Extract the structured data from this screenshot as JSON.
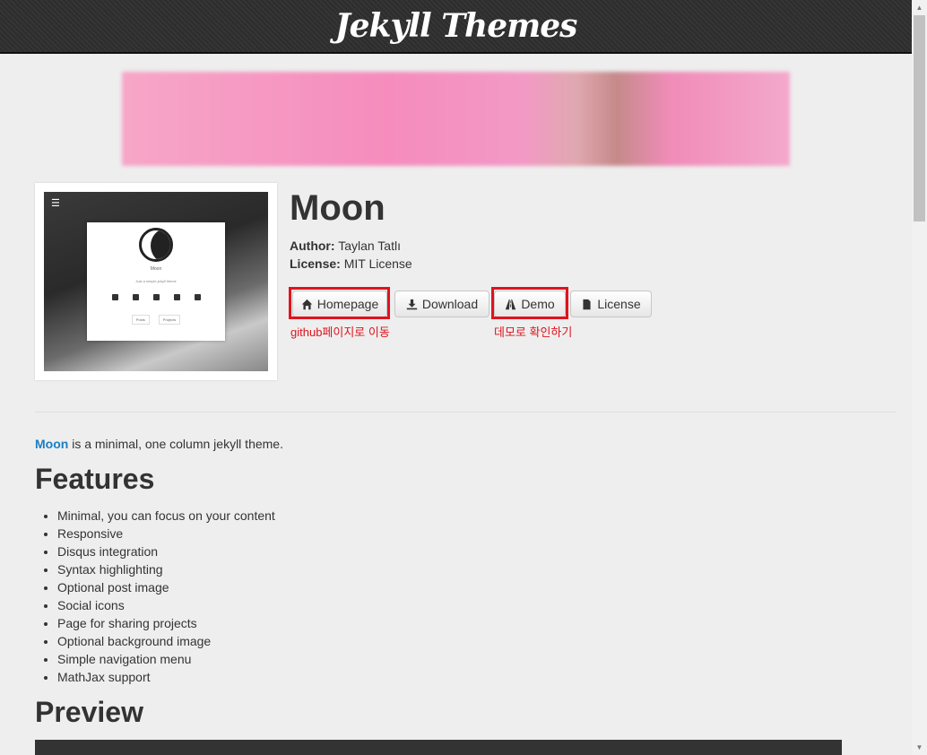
{
  "header": {
    "brand": "Jekyll Themes"
  },
  "theme": {
    "name": "Moon",
    "author_label": "Author:",
    "author": "Taylan Tatlı",
    "license_label": "License:",
    "license": "MIT License"
  },
  "buttons": {
    "homepage": "Homepage",
    "download": "Download",
    "demo": "Demo",
    "license": "License"
  },
  "annotations": {
    "homepage_note": "github페이지로 이동",
    "demo_note": "데모로 확인하기",
    "color": "#e0131e"
  },
  "thumbnail": {
    "site_title": "Moon",
    "tagline": "Just a simple jekyll theme",
    "link1": "Posts",
    "link2": "Projects"
  },
  "content": {
    "intro_link": "Moon",
    "intro_rest": " is a minimal, one column jekyll theme.",
    "features_heading": "Features",
    "features": [
      "Minimal, you can focus on your content",
      "Responsive",
      "Disqus integration",
      "Syntax highlighting",
      "Optional post image",
      "Social icons",
      "Page for sharing projects",
      "Optional background image",
      "Simple navigation menu",
      "MathJax support"
    ],
    "preview_heading": "Preview"
  },
  "colors": {
    "link": "#1a7fc4",
    "header_bg": "#333333",
    "page_bg": "#eeeeee"
  }
}
